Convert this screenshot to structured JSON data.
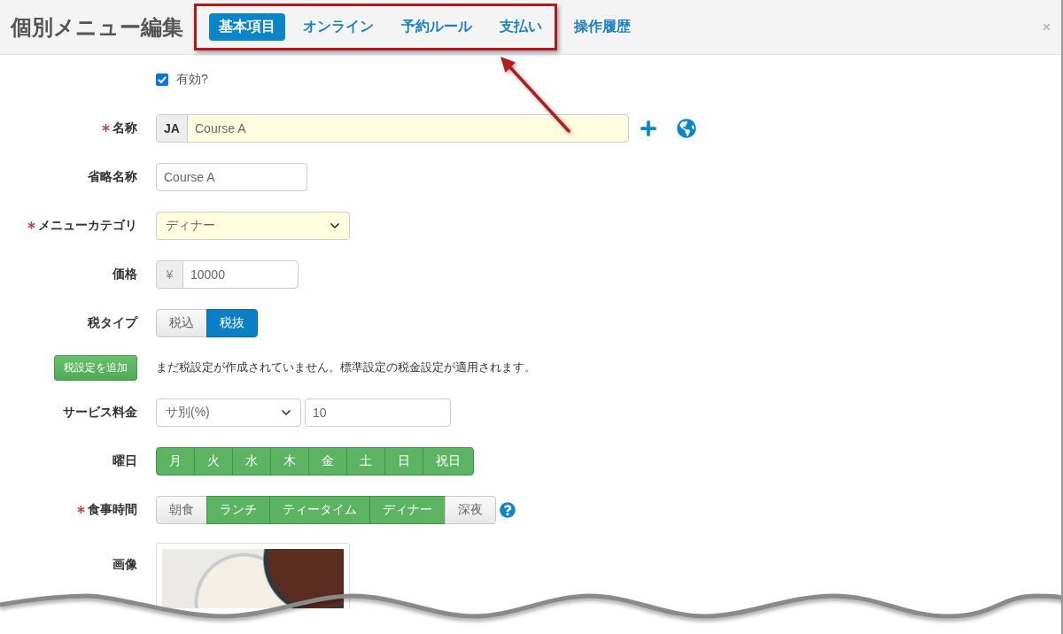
{
  "header": {
    "title": "個別メニュー編集",
    "tabs": [
      {
        "label": "基本項目",
        "selected": true,
        "framed": true
      },
      {
        "label": "オンライン",
        "selected": false,
        "framed": true
      },
      {
        "label": "予約ルール",
        "selected": false,
        "framed": true
      },
      {
        "label": "支払い",
        "selected": false,
        "framed": true
      },
      {
        "label": "操作履歴",
        "selected": false,
        "framed": false
      }
    ]
  },
  "form": {
    "enabled": {
      "label": "有効?",
      "checked": true
    },
    "rows": [
      {
        "kind": "language_text",
        "label": "名称",
        "required": true,
        "language": "JA",
        "value": "Course A"
      },
      {
        "kind": "text",
        "label": "省略名称",
        "required": false,
        "value": "Course A"
      },
      {
        "kind": "select",
        "label": "メニューカテゴリ",
        "required": true,
        "value": "ディナー"
      },
      {
        "kind": "currency",
        "label": "価格",
        "required": false,
        "currency": "¥",
        "value": "10000"
      },
      {
        "kind": "radio_group",
        "label": "税タイプ",
        "required": false,
        "options": [
          {
            "label": "税込",
            "selected": false
          },
          {
            "label": "税抜",
            "selected": true
          }
        ]
      },
      {
        "kind": "action",
        "button": "税設定を追加",
        "note": "まだ税設定が作成されていません。標準設定の税金設定が適用されます。"
      },
      {
        "kind": "select_number",
        "label": "サービス料金",
        "required": false,
        "mode": "サ別(%)",
        "value": "10"
      },
      {
        "kind": "check_group",
        "label": "曜日",
        "required": false,
        "help": false,
        "options": [
          {
            "label": "月",
            "selected": true
          },
          {
            "label": "火",
            "selected": true
          },
          {
            "label": "水",
            "selected": true
          },
          {
            "label": "木",
            "selected": true
          },
          {
            "label": "金",
            "selected": true
          },
          {
            "label": "土",
            "selected": true
          },
          {
            "label": "日",
            "selected": true
          },
          {
            "label": "祝日",
            "selected": true
          }
        ]
      },
      {
        "kind": "check_group",
        "label": "食事時間",
        "required": true,
        "help": true,
        "options": [
          {
            "label": "朝食",
            "selected": false
          },
          {
            "label": "ランチ",
            "selected": true
          },
          {
            "label": "ティータイム",
            "selected": true
          },
          {
            "label": "ディナー",
            "selected": true
          },
          {
            "label": "深夜",
            "selected": false
          }
        ]
      },
      {
        "kind": "image",
        "label": "画像",
        "required": false
      }
    ]
  }
}
